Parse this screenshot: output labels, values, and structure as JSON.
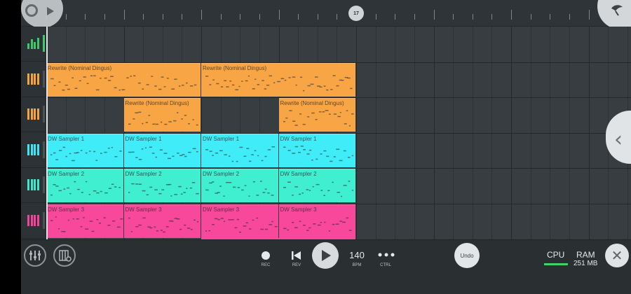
{
  "timeline": {
    "playhead_marker": "17"
  },
  "tracks": [
    {
      "icon": "mixer-icon",
      "color": "#3fc86a"
    },
    {
      "icon": "piano-icon",
      "color": "#f4a43f"
    },
    {
      "icon": "piano-icon",
      "color": "#f4a43f"
    },
    {
      "icon": "piano-icon",
      "color": "#3ee6f2"
    },
    {
      "icon": "piano-icon",
      "color": "#3ee6c8"
    },
    {
      "icon": "piano-icon",
      "color": "#f2449a"
    }
  ],
  "clips": [
    {
      "label": "Rewrite (Nominal Dingus)",
      "track": 1,
      "bar": 0,
      "len": 2,
      "color": "#f7a545"
    },
    {
      "label": "Rewrite (Nominal Dingus)",
      "track": 1,
      "bar": 2,
      "len": 2,
      "color": "#f7a545"
    },
    {
      "label": "Rewrite (Nominal Dingus)",
      "track": 2,
      "bar": 1,
      "len": 1,
      "color": "#f7a545"
    },
    {
      "label": "Rewrite (Nominal Dingus)",
      "track": 2,
      "bar": 3,
      "len": 1,
      "color": "#f7a545"
    },
    {
      "label": "DW Sampler 1",
      "track": 3,
      "bar": 0,
      "len": 1,
      "color": "#40ecf7"
    },
    {
      "label": "DW Sampler 1",
      "track": 3,
      "bar": 1,
      "len": 1,
      "color": "#40ecf7"
    },
    {
      "label": "DW Sampler 1",
      "track": 3,
      "bar": 2,
      "len": 1,
      "color": "#40ecf7"
    },
    {
      "label": "DW Sampler 1",
      "track": 3,
      "bar": 3,
      "len": 1,
      "color": "#40ecf7"
    },
    {
      "label": "DW Sampler 2",
      "track": 4,
      "bar": 0,
      "len": 1,
      "color": "#40eed0"
    },
    {
      "label": "DW Sampler 2",
      "track": 4,
      "bar": 1,
      "len": 1,
      "color": "#40eed0"
    },
    {
      "label": "DW Sampler 2",
      "track": 4,
      "bar": 2,
      "len": 1,
      "color": "#40eed0"
    },
    {
      "label": "DW Sampler 2",
      "track": 4,
      "bar": 3,
      "len": 1,
      "color": "#40eed0"
    },
    {
      "label": "DW Sampler 3",
      "track": 5,
      "bar": 0,
      "len": 1,
      "color": "#f7489c"
    },
    {
      "label": "DW Sampler 3",
      "track": 5,
      "bar": 1,
      "len": 1,
      "color": "#f7489c"
    },
    {
      "label": "DW Sampler 3",
      "track": 5,
      "bar": 2,
      "len": 1,
      "color": "#f7489c"
    },
    {
      "label": "DW Sampler 3",
      "track": 5,
      "bar": 3,
      "len": 1,
      "color": "#f7489c"
    }
  ],
  "transport": {
    "rec_label": "REC",
    "rev_label": "REV",
    "bpm_value": "140",
    "bpm_label": "BPM",
    "ctrl_label": "CTRL",
    "undo_label": "Undo"
  },
  "status": {
    "cpu_label": "CPU",
    "ram_label": "RAM",
    "ram_value": "251 MB",
    "cpu_color": "#3fd46b"
  },
  "icons": {
    "mixer": "mixer-icon",
    "piano_settings": "piano-settings-icon",
    "close": "close-icon",
    "side_tab": "chevron-left-icon",
    "logo": "fl-logo-icon"
  }
}
